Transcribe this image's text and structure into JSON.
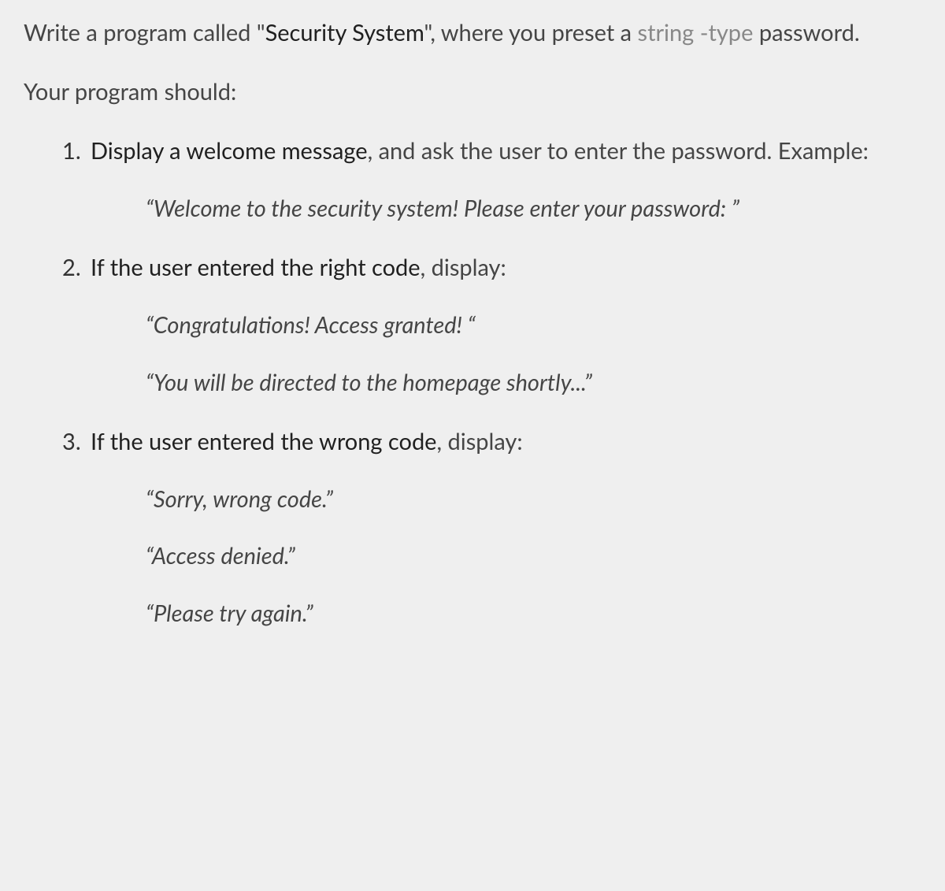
{
  "intro": {
    "part1": "Write a program called \"",
    "strong1": "Security System",
    "part2": "\", where you preset a ",
    "muted1": "string",
    "muted2": " -type ",
    "part3": "password."
  },
  "lead": "Your program should:",
  "items": [
    {
      "strong": "Display a welcome message",
      "rest": ", and ask the user to enter the password. Example:",
      "quotes": [
        "“Welcome to the security system!  Please enter your password: ”"
      ]
    },
    {
      "strong": "If the user entered the right code",
      "rest": ", display:",
      "quotes": [
        "“Congratulations! Access granted! “",
        "“You will be directed to the homepage shortly...”"
      ]
    },
    {
      "strong": "If the user entered the wrong code",
      "rest": ", display:",
      "quotes": [
        "“Sorry, wrong code.”",
        "“Access denied.”",
        "“Please try again.”"
      ]
    }
  ]
}
